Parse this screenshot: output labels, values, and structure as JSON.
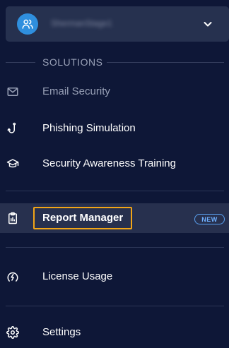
{
  "org": {
    "name": "ShermanStage1",
    "avatar_icon": "users-icon",
    "chevron_icon": "chevron-down-icon"
  },
  "section": {
    "label": "SOLUTIONS"
  },
  "nav": {
    "email": {
      "label": "Email Security",
      "icon": "mail-icon"
    },
    "phishing": {
      "label": "Phishing Simulation",
      "icon": "hook-icon"
    },
    "training": {
      "label": "Security Awareness Training",
      "icon": "graduation-cap-icon"
    },
    "report": {
      "label": "Report Manager",
      "icon": "clipboard-icon",
      "badge": "NEW"
    },
    "license": {
      "label": "License Usage",
      "icon": "gauge-bolt-icon"
    },
    "settings": {
      "label": "Settings",
      "icon": "gear-icon"
    }
  },
  "colors": {
    "background": "#0e1737",
    "active_bg": "#27304e",
    "highlight": "#f2a517",
    "badge": "#5aa0f0",
    "avatar": "#2f8fde"
  }
}
